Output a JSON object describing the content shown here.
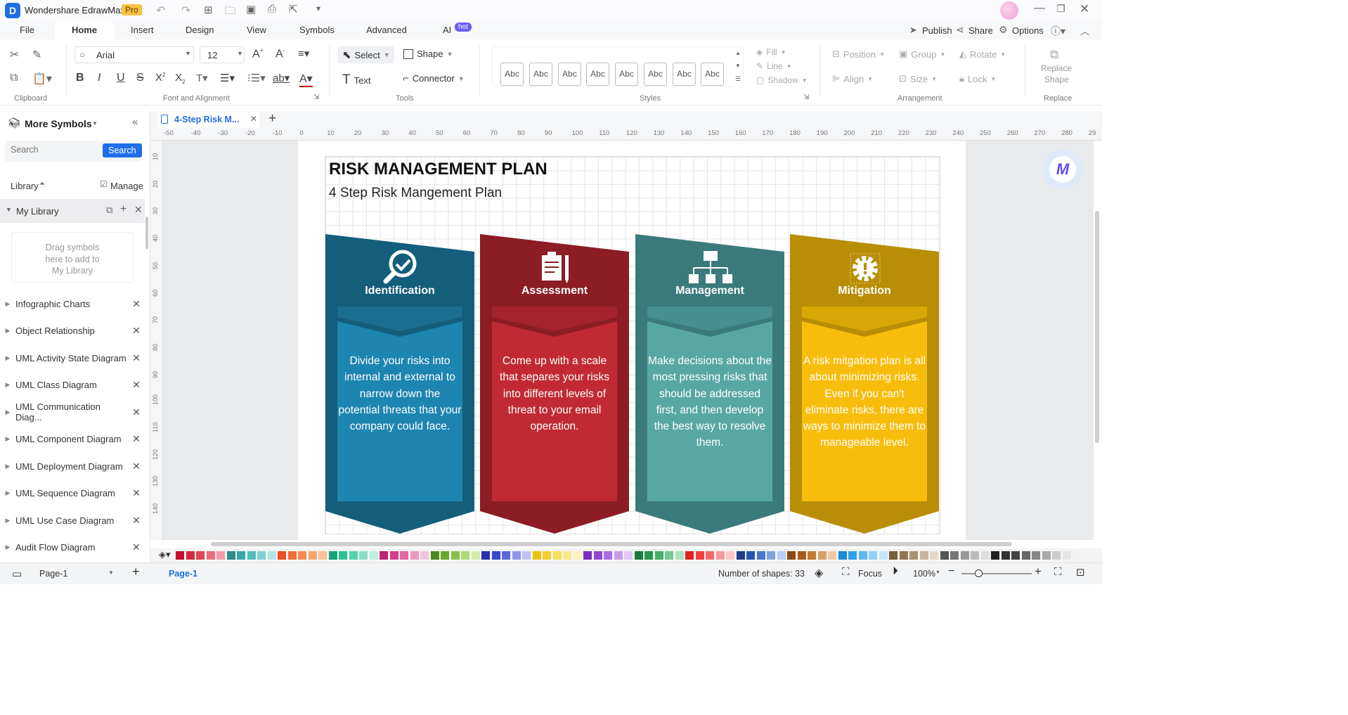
{
  "app": {
    "title": "Wondershare EdrawMax",
    "badge": "Pro"
  },
  "menu": {
    "items": [
      "File",
      "Home",
      "Insert",
      "Design",
      "View",
      "Symbols",
      "Advanced",
      "AI"
    ],
    "ai_badge": "hot",
    "publish": "Publish",
    "share": "Share",
    "options": "Options"
  },
  "ribbon": {
    "font_name": "Arial",
    "font_size": "12",
    "select": "Select",
    "shape": "Shape",
    "text": "Text",
    "connector": "Connector",
    "style_sample": "Abc",
    "fill": "Fill",
    "line": "Line",
    "shadow": "Shadow",
    "position": "Position",
    "group": "Group",
    "rotate": "Rotate",
    "align": "Align",
    "size": "Size",
    "lock": "Lock",
    "replace_shape_1": "Replace",
    "replace_shape_2": "Shape",
    "groups": {
      "clipboard": "Clipboard",
      "font": "Font and Alignment",
      "tools": "Tools",
      "styles": "Styles",
      "arrangement": "Arrangement",
      "replace": "Replace"
    }
  },
  "sidebar": {
    "title": "More Symbols",
    "search_placeholder": "Search",
    "search_button": "Search",
    "library": "Library",
    "manage": "Manage",
    "my_library": "My Library",
    "drag_hint_1": "Drag symbols",
    "drag_hint_2": "here to add to",
    "drag_hint_3": "My Library",
    "items": [
      "Infographic Charts",
      "Object Relationship",
      "UML Activity State Diagram",
      "UML Class Diagram",
      "UML Communication Diag...",
      "UML Component Diagram",
      "UML Deployment Diagram",
      "UML Sequence Diagram",
      "UML Use Case Diagram",
      "Audit Flow Diagram"
    ]
  },
  "document": {
    "tab": "4-Step Risk M...",
    "ruler": [
      "-50",
      "-40",
      "-30",
      "-20",
      "-10",
      "0",
      "10",
      "20",
      "30",
      "40",
      "50",
      "60",
      "70",
      "80",
      "90",
      "100",
      "110",
      "120",
      "130",
      "140",
      "150",
      "160",
      "170",
      "180",
      "190",
      "200",
      "210",
      "220",
      "230",
      "240",
      "250",
      "260",
      "270",
      "280",
      "29"
    ],
    "vruler": [
      "10",
      "20",
      "30",
      "40",
      "50",
      "60",
      "70",
      "80",
      "90",
      "100",
      "110",
      "120",
      "130",
      "140"
    ]
  },
  "diagram": {
    "title": "RISK MANAGEMENT PLAN",
    "subtitle": "4 Step Risk Mangement Plan",
    "cards": [
      {
        "title": "Identification",
        "text": "Divide your risks into internal and external to narrow down the potential threats that your company could face.",
        "icon": "magnifier-check-icon",
        "colors": {
          "dark": "#135e7a",
          "mid": "#1a6e8f",
          "light": "#1d85b0"
        }
      },
      {
        "title": "Assessment",
        "text": "Come up with a scale that separes your risks into different levels of threat to your email operation.",
        "icon": "clipboard-icon",
        "colors": {
          "dark": "#8c1d25",
          "mid": "#a4232c",
          "light": "#c12a34"
        }
      },
      {
        "title": "Management",
        "text": "Make decisions about the most pressing risks that should be addressed first, and then develop the best way to resolve them.",
        "icon": "hierarchy-icon",
        "colors": {
          "dark": "#3b7a7c",
          "mid": "#468e90",
          "light": "#58a7a5"
        }
      },
      {
        "title": "Mitigation",
        "text": "A risk mitgation plan is all about minimizing risks. Even if you can't eliminate risks, there are ways to minimize them to manageable level.",
        "icon": "gear-warning-icon",
        "colors": {
          "dark": "#b98e06",
          "mid": "#d7a705",
          "light": "#f8bd0c"
        }
      }
    ]
  },
  "status": {
    "page_select": "Page-1",
    "page_tab": "Page-1",
    "shapes": "Number of shapes: 33",
    "focus": "Focus",
    "zoom": "100%"
  }
}
